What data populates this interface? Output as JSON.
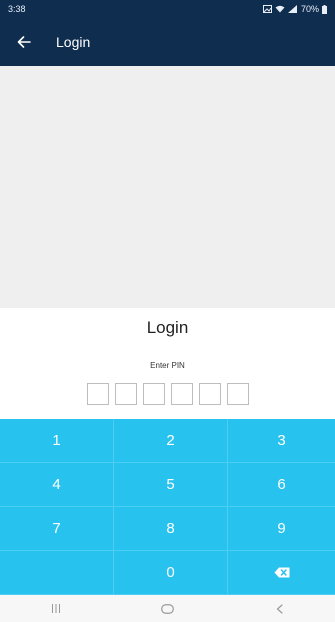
{
  "status_bar": {
    "time": "3:38",
    "battery_text": "70%"
  },
  "app_bar": {
    "title": "Login",
    "background_color": "#0f2d4f"
  },
  "banner": {
    "background_color": "#efefef"
  },
  "login": {
    "heading": "Login",
    "pin_label": "Enter PIN",
    "pin_length": 6
  },
  "keypad": {
    "background_color": "#27c2ee",
    "keys": [
      {
        "label": "1"
      },
      {
        "label": "2"
      },
      {
        "label": "3"
      },
      {
        "label": "4"
      },
      {
        "label": "5"
      },
      {
        "label": "6"
      },
      {
        "label": "7"
      },
      {
        "label": "8"
      },
      {
        "label": "9"
      },
      {
        "label": ""
      },
      {
        "label": "0"
      },
      {
        "label": "",
        "icon": "backspace-icon"
      }
    ]
  },
  "nav_bar": {
    "recents_icon": "recents-icon",
    "home_icon": "home-icon",
    "back_icon": "back-nav-icon"
  }
}
